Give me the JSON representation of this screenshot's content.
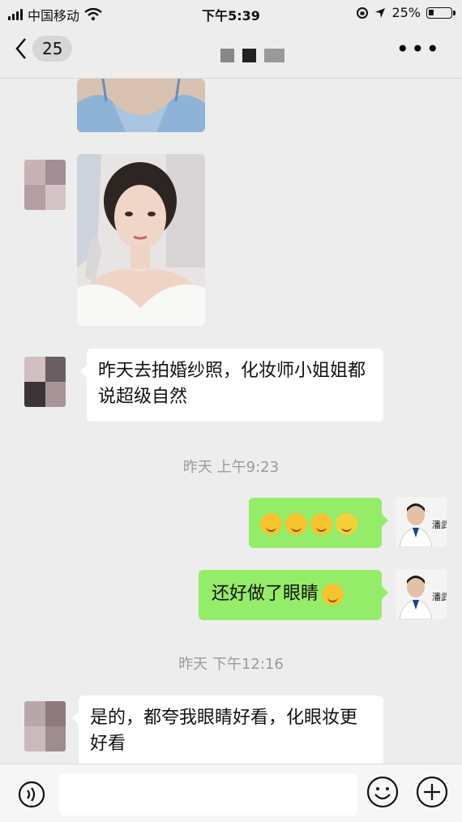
{
  "status_bar": {
    "carrier": "中国移动",
    "time": "下午5:39",
    "battery": "25%",
    "battery_level": 0.25
  },
  "nav": {
    "back_count": "25",
    "more": "•••"
  },
  "messages": {
    "m1_text": "昨天去拍婚纱照，化妆师小姐姐都说超级自然",
    "ts1": "昨天 上午9:23",
    "m3_text": "还好做了眼睛",
    "doctor_sign": "潘武",
    "ts2": "昨天 下午12:16",
    "m4_text": "是的，都夸我眼睛好看，化眼妆更好看"
  },
  "colors": {
    "background": "#ededed",
    "sent_bubble": "#95ec69",
    "received_bubble": "#ffffff",
    "timestamp": "#9a9a9a"
  },
  "input_bar": {
    "text_value": ""
  }
}
